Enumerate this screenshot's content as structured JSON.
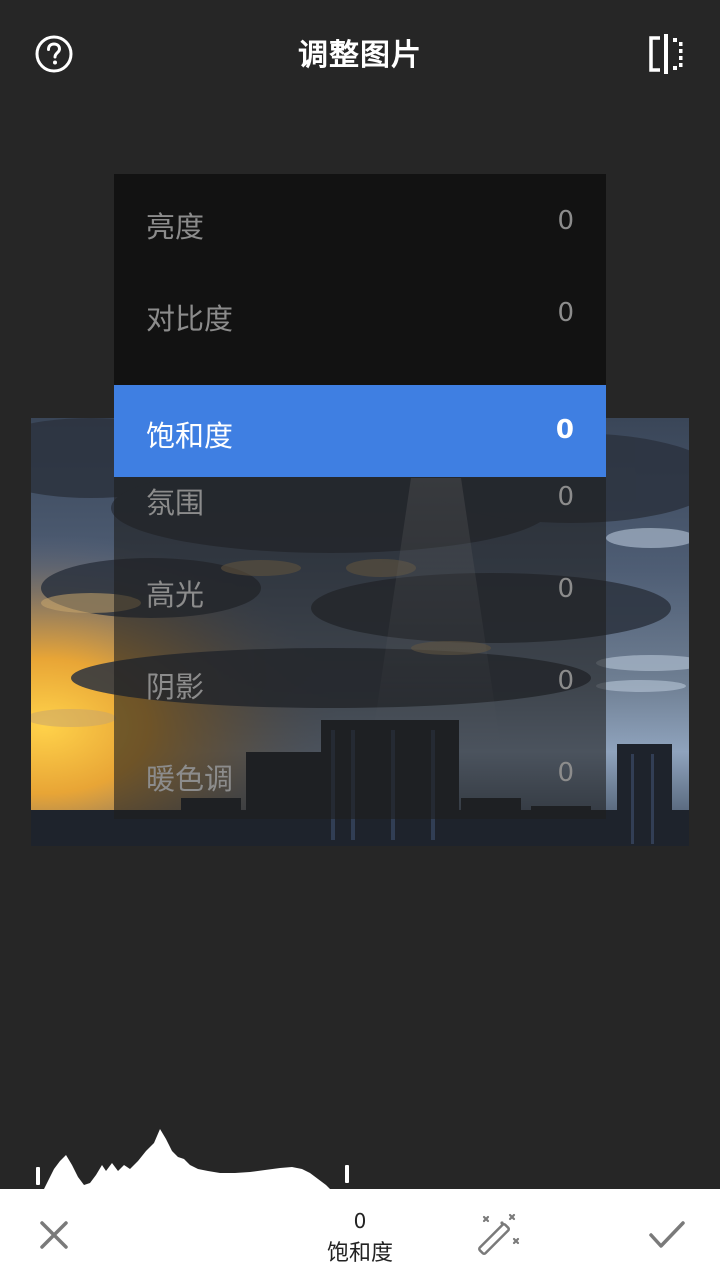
{
  "header": {
    "title": "调整图片",
    "help_icon": "help-circle-icon",
    "compare_icon": "split-compare-icon"
  },
  "menu": {
    "items": [
      {
        "label": "亮度",
        "value": "0"
      },
      {
        "label": "对比度",
        "value": "0"
      },
      {
        "label": "饱和度",
        "value": "0",
        "selected": true
      },
      {
        "label": "氛围",
        "value": "0"
      },
      {
        "label": "高光",
        "value": "0"
      },
      {
        "label": "阴影",
        "value": "0"
      },
      {
        "label": "暖色调",
        "value": "0"
      }
    ],
    "selected_color": "#3f7fe2"
  },
  "bottom_bar": {
    "param_value": "0",
    "param_name": "饱和度",
    "cancel_icon": "close-icon",
    "auto_icon": "magic-wand-icon",
    "apply_icon": "checkmark-icon"
  }
}
